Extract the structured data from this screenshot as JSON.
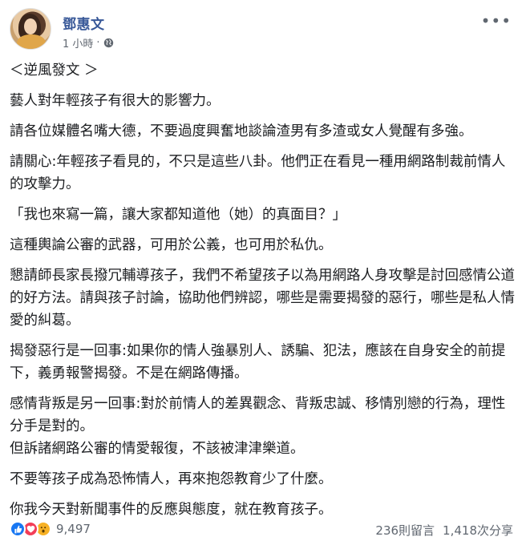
{
  "author": {
    "name": "鄧惠文"
  },
  "meta": {
    "time": "1 小時",
    "separator": "·"
  },
  "post": {
    "title": "＜逆風發文 ＞",
    "paragraphs": [
      "藝人對年輕孩子有很大的影響力。",
      "請各位媒體名嘴大德，不要過度興奮地談論渣男有多渣或女人覺醒有多強。",
      "請關心:年輕孩子看見的，不只是這些八卦。他們正在看見一種用網路制裁前情人的攻擊力。",
      "「我也來寫一篇，讓大家都知道他（她）的真面目？」",
      "這種輿論公審的武器，可用於公義，也可用於私仇。",
      "懇請師長家長撥冗輔導孩子，我們不希望孩子以為用網路人身攻擊是討回感情公道的好方法。請與孩子討論，協助他們辨認，哪些是需要揭發的惡行，哪些是私人情愛的糾葛。",
      "揭發惡行是一回事:如果你的情人強暴別人、誘騙、犯法，應該在自身安全的前提下，義勇報警揭發。不是在網路傳播。",
      "感情背叛是另一回事:對於前情人的差異觀念、背叛忠誠、移情別戀的行為，理性分手是對的。",
      "但訴諸網路公審的情愛報復，不該被津津樂道。",
      "不要等孩子成為恐怖情人，再來抱怨教育少了什麼。",
      "你我今天對新聞事件的反應與態度，就在教育孩子。"
    ]
  },
  "footer": {
    "reaction_count": "9,497",
    "comments": "236則留言",
    "shares": "1,418次分享"
  },
  "icons": {
    "more": "more-dots-icon",
    "globe": "globe-icon",
    "like": "like-reaction-icon",
    "love": "love-reaction-icon",
    "wow": "wow-reaction-icon"
  },
  "colors": {
    "author_link": "#385898",
    "like": "#1877f2",
    "love": "#f33e58",
    "wow": "#f7b125"
  }
}
